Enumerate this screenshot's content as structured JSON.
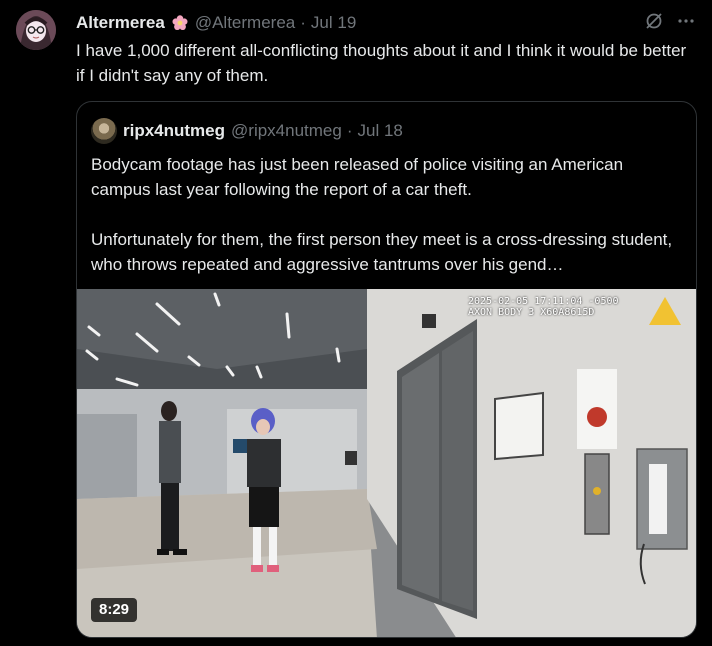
{
  "tweet": {
    "author_name": "Altermerea",
    "author_handle": "@Altermerea",
    "date": "Jul 19",
    "text": "I have 1,000 different all-conflicting thoughts about it and I think it would be better if I didn't say any of them."
  },
  "quoted": {
    "author_name": "ripx4nutmeg",
    "author_handle": "@ripx4nutmeg",
    "date": "Jul 18",
    "paragraph_1": "Bodycam footage has just been released of police visiting an American campus last year following the report of a car theft.",
    "paragraph_2": "Unfortunately for them, the first person they meet is a cross-dressing student, who throws repeated and aggressive tantrums over his gend…",
    "media": {
      "timestamp_line_1": "2025-02-05 17:11:04 -0500",
      "timestamp_line_2": "AXON BODY 3 X60A8615D",
      "duration": "8:29"
    }
  },
  "icons": {
    "grok": "grok-icon",
    "more": "more-icon",
    "emoji": "flower-emoji-icon"
  }
}
